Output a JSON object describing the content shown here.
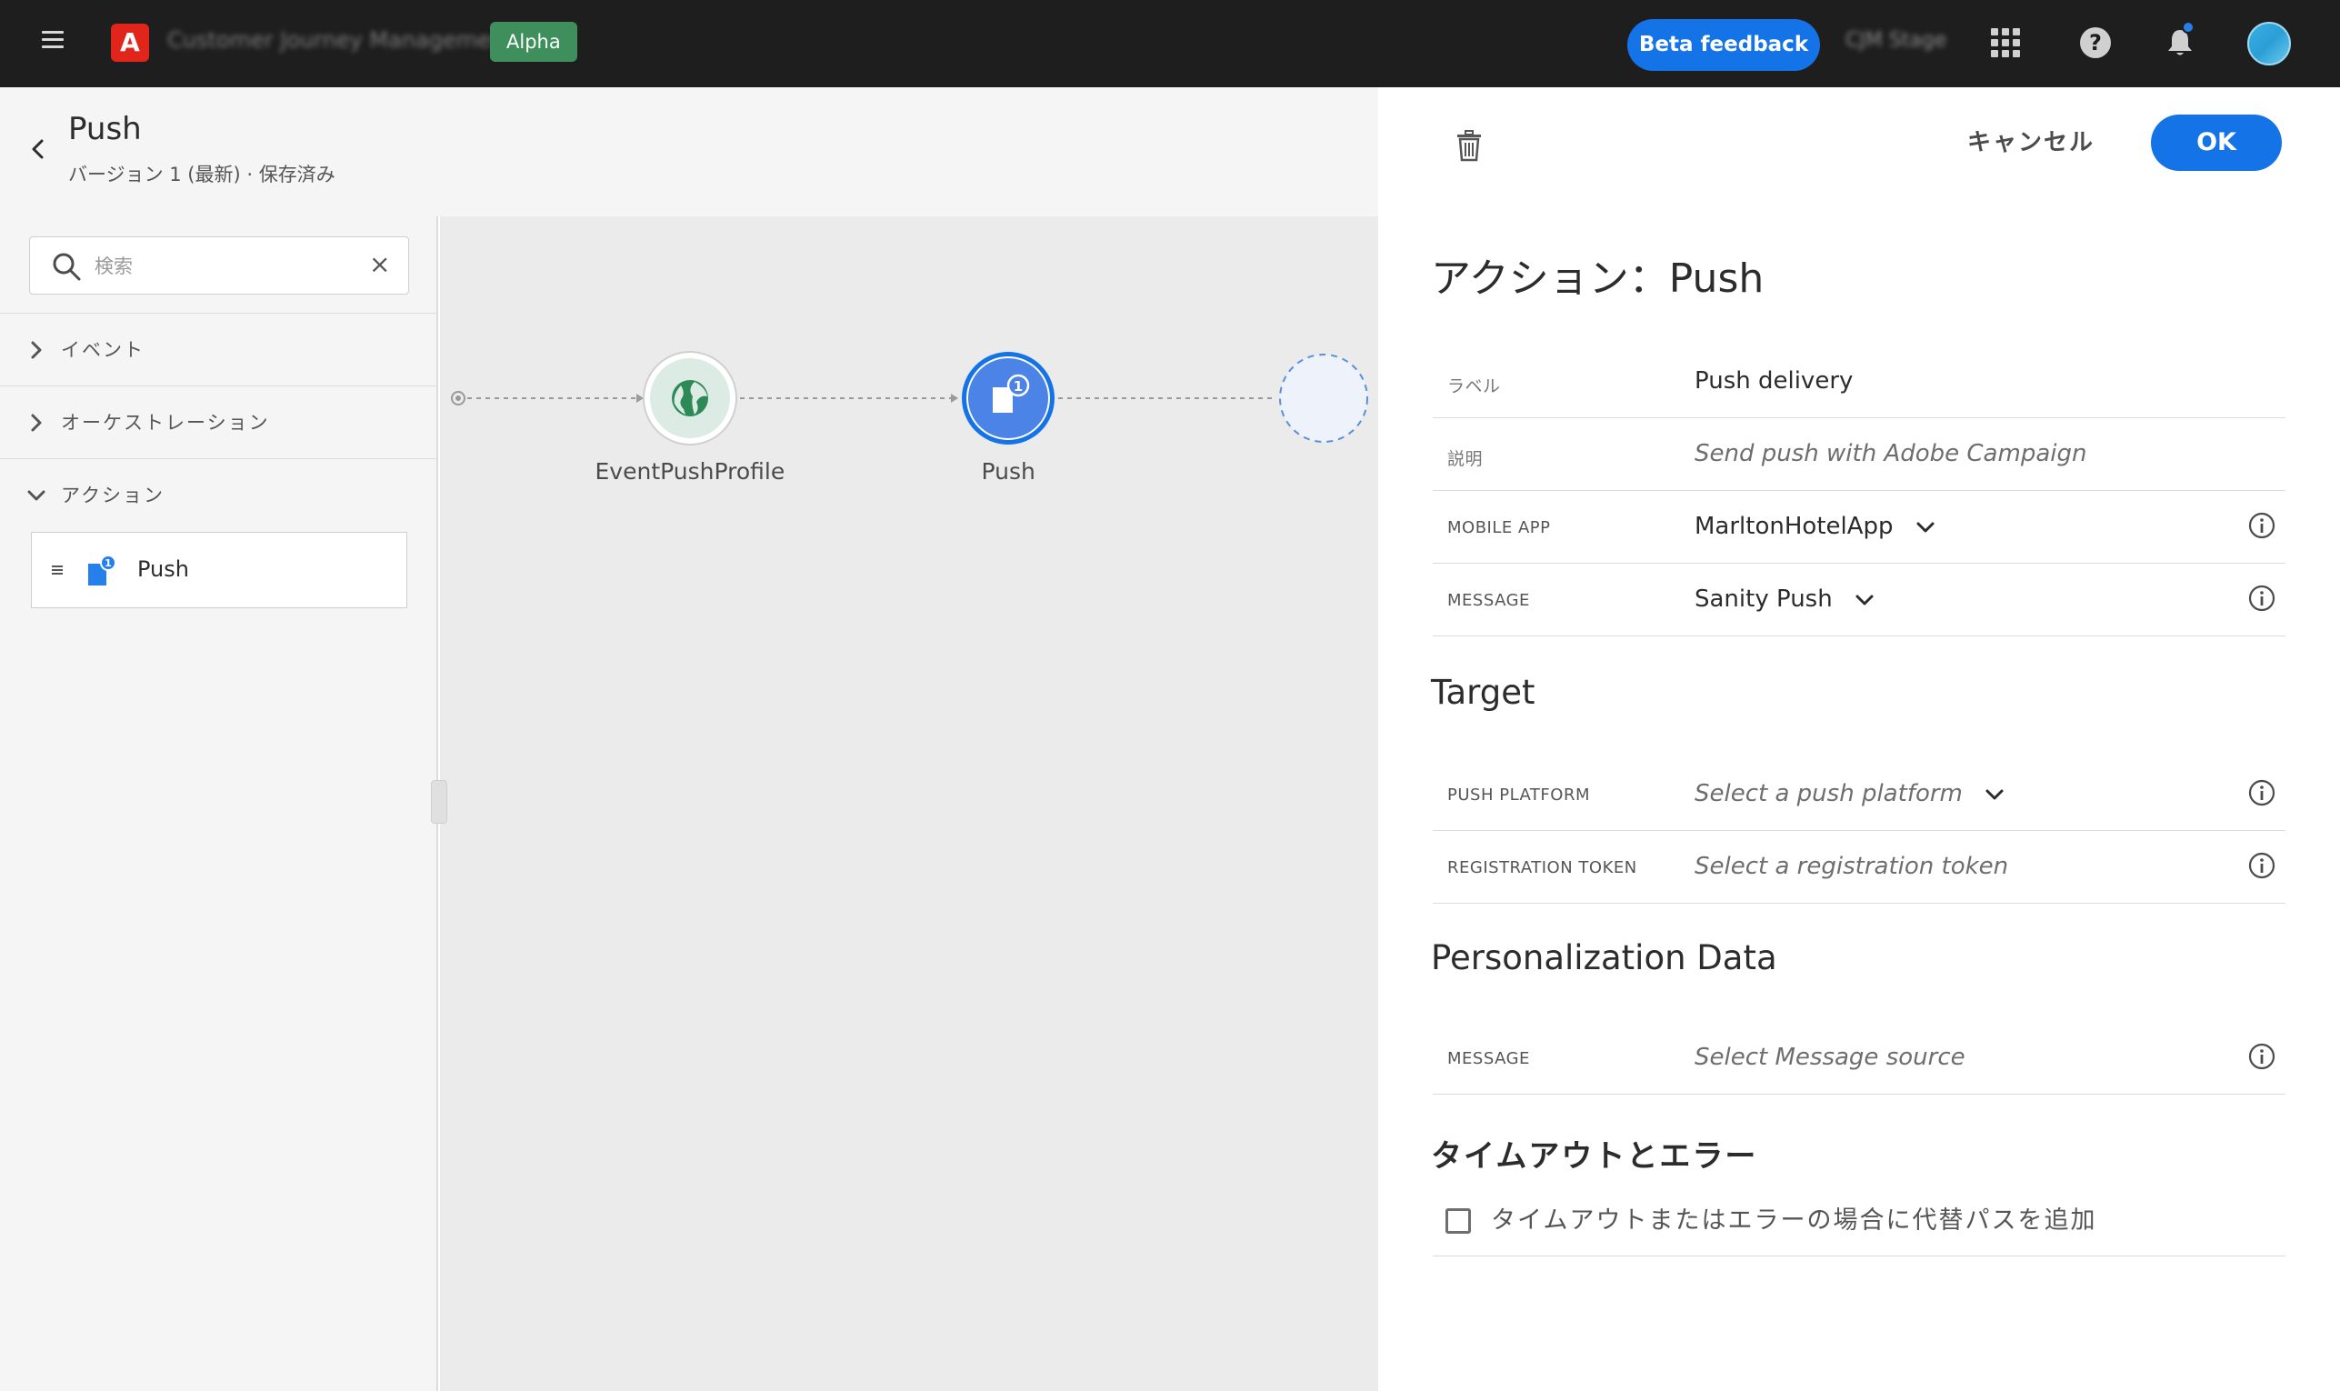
{
  "topbar": {
    "app_name": "Customer Journey Management",
    "env_badge": "Alpha",
    "beta_feedback": "Beta feedback",
    "org_name": "CJM Stage"
  },
  "journey": {
    "title": "Push",
    "version": "バージョン 1 (最新) · 保存済み"
  },
  "sidebar": {
    "search_placeholder": "検索",
    "categories": [
      {
        "label": "イベント",
        "expanded": false
      },
      {
        "label": "オーケストレーション",
        "expanded": false
      },
      {
        "label": "アクション",
        "expanded": true
      }
    ],
    "action_items": [
      {
        "label": "Push",
        "badge": "1"
      }
    ]
  },
  "canvas": {
    "nodes": [
      {
        "label": "EventPushProfile",
        "type": "event",
        "icon": "globe-icon"
      },
      {
        "label": "Push",
        "type": "action",
        "icon": "push-icon",
        "badge": "1"
      },
      {
        "label": "",
        "type": "placeholder"
      }
    ]
  },
  "panel": {
    "cancel": "キャンセル",
    "ok": "OK",
    "title": "アクション：Push",
    "fields": {
      "label": {
        "key": "ラベル",
        "value": "Push delivery"
      },
      "description": {
        "key": "説明",
        "placeholder": "Send push with Adobe Campaign"
      },
      "mobile_app": {
        "key": "MOBILE APP",
        "value": "MarltonHotelApp"
      },
      "message": {
        "key": "MESSAGE",
        "value": "Sanity Push"
      }
    },
    "target": {
      "heading": "Target",
      "push_platform": {
        "key": "PUSH PLATFORM",
        "placeholder": "Select a push platform"
      },
      "registration_token": {
        "key": "REGISTRATION TOKEN",
        "placeholder": "Select a registration token"
      }
    },
    "personalization": {
      "heading": "Personalization Data",
      "message": {
        "key": "MESSAGE",
        "placeholder": "Select Message source"
      }
    },
    "timeout": {
      "heading": "タイムアウトとエラー",
      "checkbox_label": "タイムアウトまたはエラーの場合に代替パスを追加",
      "checked": false
    }
  },
  "colors": {
    "accent": "#1473e6",
    "topbar": "#1e1e1e",
    "alpha_badge": "#3f8f5c",
    "node_push": "#4b83e6",
    "node_event": "#d9ebe2"
  }
}
